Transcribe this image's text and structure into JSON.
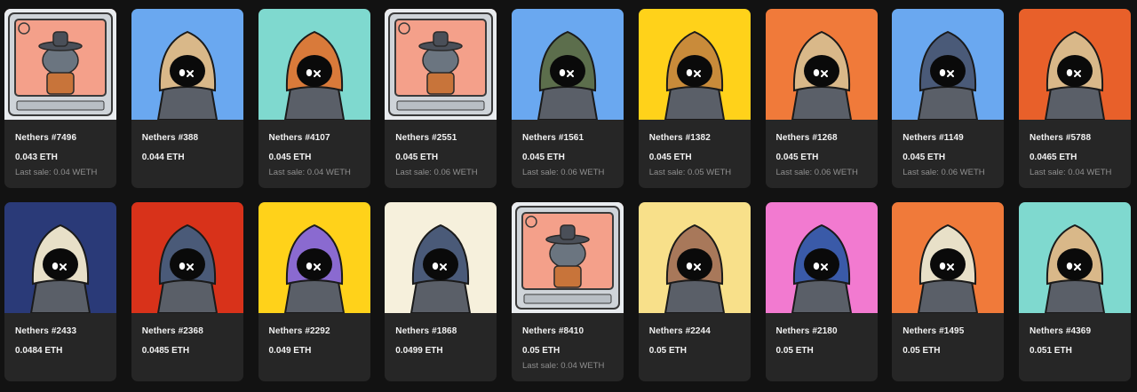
{
  "cards": [
    {
      "name": "Nethers #7496",
      "price": "0.043 ETH",
      "last_sale": "Last sale: 0.04 WETH",
      "bg": "#f4a08a",
      "hood": "tv"
    },
    {
      "name": "Nethers #388",
      "price": "0.044 ETH",
      "last_sale": "",
      "bg": "#6aa8f0",
      "hood": "#d9b889"
    },
    {
      "name": "Nethers #4107",
      "price": "0.045 ETH",
      "last_sale": "Last sale: 0.04 WETH",
      "bg": "#7fd9cf",
      "hood": "#d97a3a"
    },
    {
      "name": "Nethers #2551",
      "price": "0.045 ETH",
      "last_sale": "Last sale: 0.06 WETH",
      "bg": "#f4a08a",
      "hood": "tv"
    },
    {
      "name": "Nethers #1561",
      "price": "0.045 ETH",
      "last_sale": "Last sale: 0.06 WETH",
      "bg": "#6aa8f0",
      "hood": "#5c6e4c"
    },
    {
      "name": "Nethers #1382",
      "price": "0.045 ETH",
      "last_sale": "Last sale: 0.05 WETH",
      "bg": "#ffd21a",
      "hood": "#c98b3a"
    },
    {
      "name": "Nethers #1268",
      "price": "0.045 ETH",
      "last_sale": "Last sale: 0.06 WETH",
      "bg": "#f07a3a",
      "hood": "#d9b889"
    },
    {
      "name": "Nethers #1149",
      "price": "0.045 ETH",
      "last_sale": "Last sale: 0.06 WETH",
      "bg": "#6aa8f0",
      "hood": "#4a5a78"
    },
    {
      "name": "Nethers #5788",
      "price": "0.0465 ETH",
      "last_sale": "Last sale: 0.04 WETH",
      "bg": "#e8602a",
      "hood": "#d9b889"
    },
    {
      "name": "Nethers #2433",
      "price": "0.0484 ETH",
      "last_sale": "",
      "bg": "#2a3a78",
      "hood": "#e8e0c8"
    },
    {
      "name": "Nethers #2368",
      "price": "0.0485 ETH",
      "last_sale": "",
      "bg": "#d8321a",
      "hood": "#4a5a78"
    },
    {
      "name": "Nethers #2292",
      "price": "0.049 ETH",
      "last_sale": "",
      "bg": "#ffd21a",
      "hood": "#8a6ad0"
    },
    {
      "name": "Nethers #1868",
      "price": "0.0499 ETH",
      "last_sale": "",
      "bg": "#f6f0dc",
      "hood": "#4a5a78"
    },
    {
      "name": "Nethers #8410",
      "price": "0.05 ETH",
      "last_sale": "Last sale: 0.04 WETH",
      "bg": "#f4a08a",
      "hood": "tv"
    },
    {
      "name": "Nethers #2244",
      "price": "0.05 ETH",
      "last_sale": "",
      "bg": "#f8e08a",
      "hood": "#a8785a"
    },
    {
      "name": "Nethers #2180",
      "price": "0.05 ETH",
      "last_sale": "",
      "bg": "#f27ad0",
      "hood": "#3a5aa8"
    },
    {
      "name": "Nethers #1495",
      "price": "0.05 ETH",
      "last_sale": "",
      "bg": "#f07a3a",
      "hood": "#e8e0c8"
    },
    {
      "name": "Nethers #4369",
      "price": "0.051 ETH",
      "last_sale": "",
      "bg": "#7fd9cf",
      "hood": "#d9b889"
    }
  ]
}
